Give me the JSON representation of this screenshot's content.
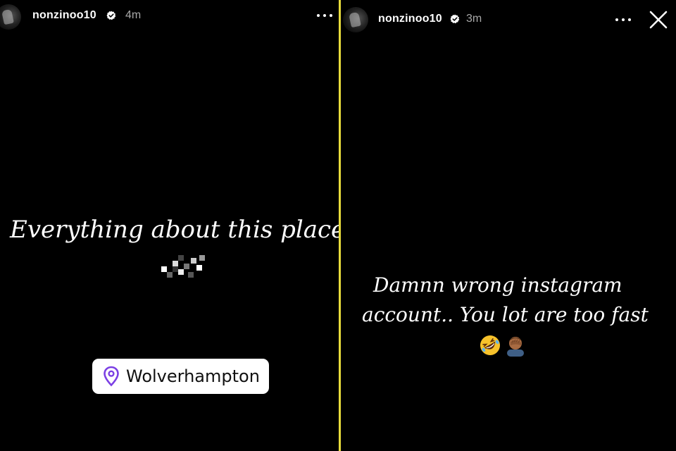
{
  "stories": {
    "left": {
      "username": "nonzinoo10",
      "time": "4m",
      "text": "Everything about this place i",
      "location": "Wolverhampton"
    },
    "right": {
      "username": "nonzinoo10",
      "time": "3m",
      "text_line1": "Damnn wrong instagram",
      "text_line2": "account.. You lot are too fast"
    }
  },
  "icons": {
    "verified": "verified-badge-icon",
    "more": "more-options-icon",
    "close": "close-icon",
    "location": "location-pin-icon",
    "emojis": [
      "rolling-on-floor-laughing-emoji",
      "facepalm-emoji"
    ]
  },
  "colors": {
    "background": "#000000",
    "divider": "#e8dc3c",
    "location_pin": "#7b3fe4",
    "time": "#a8a8a8"
  }
}
